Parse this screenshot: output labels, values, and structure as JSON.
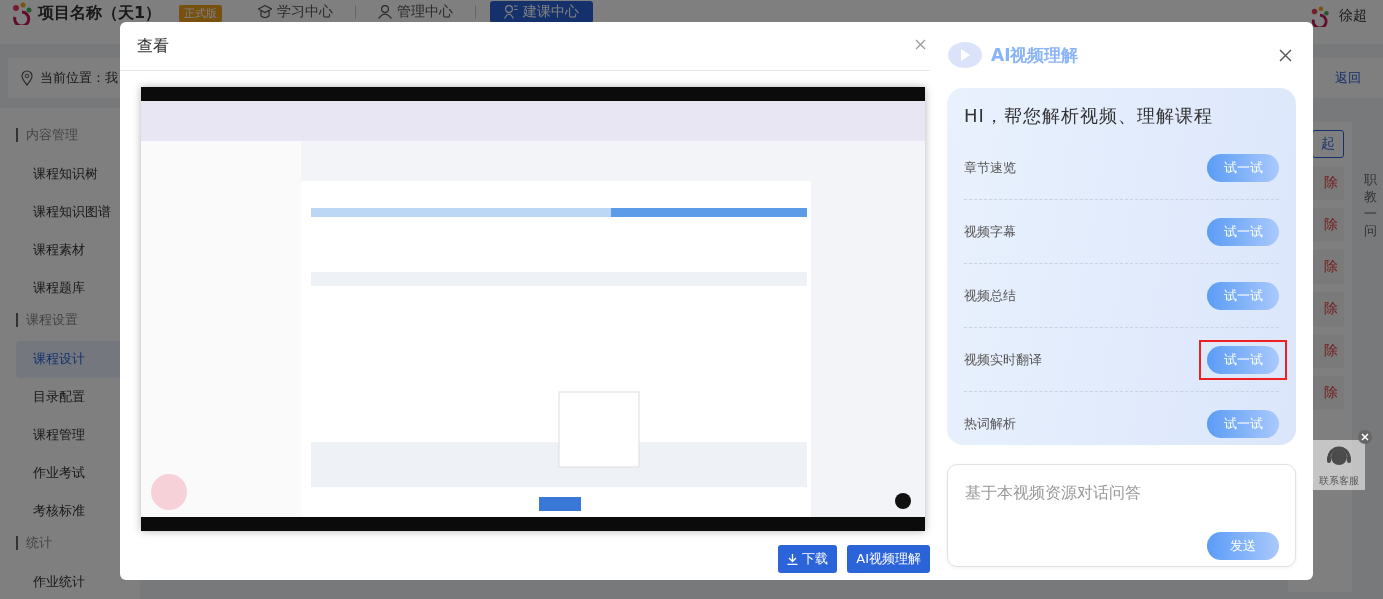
{
  "header": {
    "logo_text": "项目名称（天1）",
    "badge": "正式版",
    "nav": [
      {
        "label": "学习中心",
        "selected": false
      },
      {
        "label": "管理中心",
        "selected": false
      },
      {
        "label": "建课中心",
        "selected": true
      }
    ],
    "user": "徐超"
  },
  "breadcrumb": {
    "label": "当前位置：我",
    "back": "返回"
  },
  "sidebar": {
    "groups": [
      {
        "title": "内容管理",
        "items": [
          {
            "label": "课程知识树",
            "selected": false
          },
          {
            "label": "课程知识图谱",
            "selected": false
          },
          {
            "label": "课程素材",
            "selected": false
          },
          {
            "label": "课程题库",
            "selected": false
          }
        ]
      },
      {
        "title": "课程设置",
        "items": [
          {
            "label": "课程设计",
            "selected": true
          },
          {
            "label": "目录配置",
            "selected": false
          },
          {
            "label": "课程管理",
            "selected": false
          },
          {
            "label": "作业考试",
            "selected": false
          },
          {
            "label": "考核标准",
            "selected": false
          }
        ]
      },
      {
        "title": "统计",
        "items": [
          {
            "label": "作业统计",
            "selected": false
          }
        ]
      }
    ]
  },
  "content": {
    "collapse_button": "起",
    "rows": [
      "除",
      "除",
      "除",
      "除",
      "除",
      "除"
    ]
  },
  "side_tab": "职教一问",
  "support_widget": {
    "label": "联系客服"
  },
  "modal": {
    "title": "查看",
    "buttons": [
      {
        "label": "下载",
        "kind": "download"
      },
      {
        "label": "AI视频理解",
        "kind": "plain"
      }
    ]
  },
  "ai_panel": {
    "title": "AI视频理解",
    "greeting": "HI，帮您解析视频、理解课程",
    "features": [
      {
        "label": "章节速览",
        "button": "试一试",
        "highlighted": false
      },
      {
        "label": "视频字幕",
        "button": "试一试",
        "highlighted": false
      },
      {
        "label": "视频总结",
        "button": "试一试",
        "highlighted": false
      },
      {
        "label": "视频实时翻译",
        "button": "试一试",
        "highlighted": true
      },
      {
        "label": "热词解析",
        "button": "试一试",
        "highlighted": false
      }
    ],
    "question": {
      "placeholder": "基于本视频资源对话问答"
    },
    "send": "发送"
  }
}
